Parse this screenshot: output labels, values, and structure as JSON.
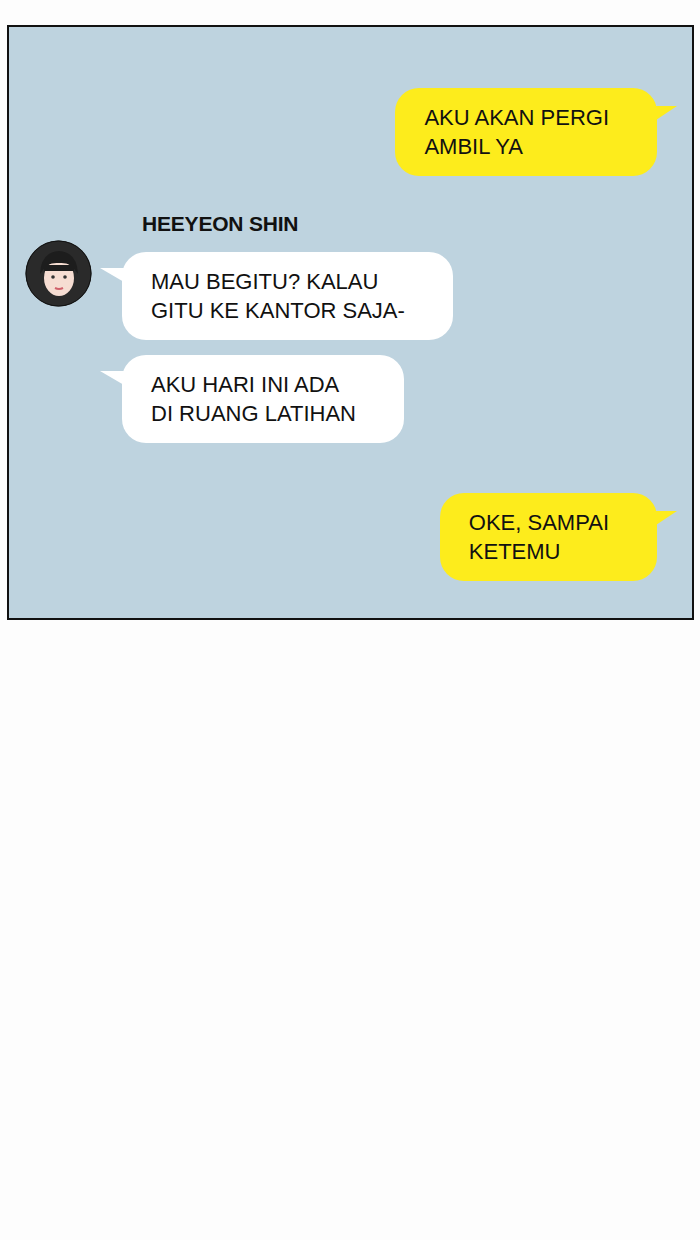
{
  "sender": {
    "name": "HEEYEON SHIN"
  },
  "conversation": [
    {
      "kind": "sent",
      "lines": [
        "AKU AKAN PERGI",
        "AMBIL YA"
      ]
    },
    {
      "kind": "received",
      "lines": [
        "MAU BEGITU? KALAU",
        "GITU KE KANTOR SAJA-"
      ]
    },
    {
      "kind": "received",
      "lines": [
        "AKU HARI INI ADA",
        "DI RUANG LATIHAN"
      ]
    },
    {
      "kind": "sent",
      "lines": [
        "OKE, SAMPAI",
        "KETEMU"
      ]
    }
  ]
}
